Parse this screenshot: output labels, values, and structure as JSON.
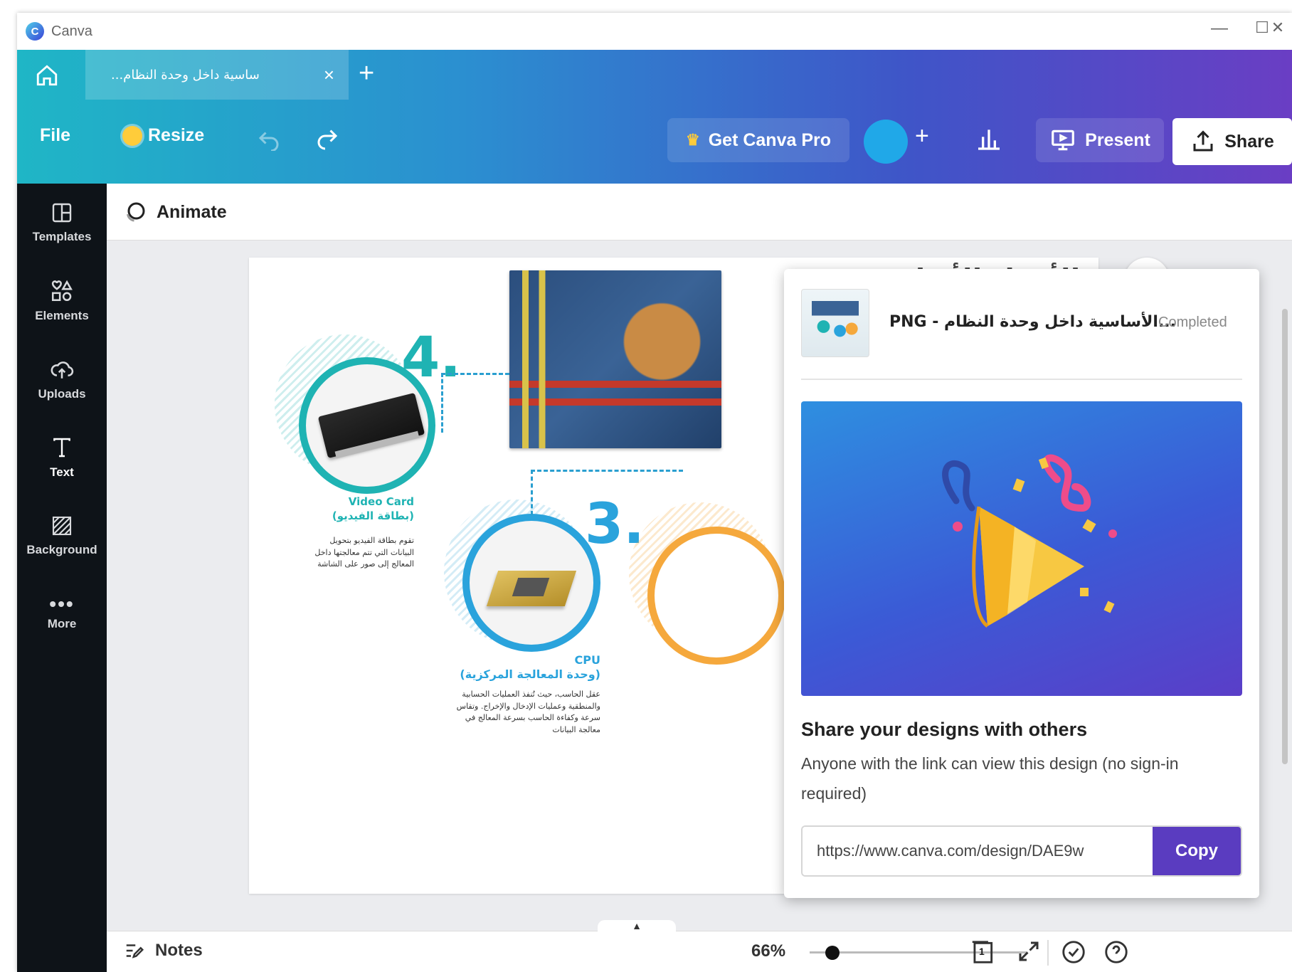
{
  "window": {
    "app_name": "Canva",
    "minimize": "—",
    "maximize": "☐",
    "close": "✕"
  },
  "tabs": {
    "active_tab_label": "...ساسية داخل وحدة النظام",
    "close": "×",
    "new": "+"
  },
  "toolbar": {
    "file": "File",
    "resize": "Resize",
    "get_pro": "Get Canva Pro",
    "plus": "+",
    "present": "Present",
    "share": "Share"
  },
  "sidebar": {
    "items": [
      {
        "label": "Templates",
        "icon": "templates-icon"
      },
      {
        "label": "Elements",
        "icon": "elements-icon"
      },
      {
        "label": "Uploads",
        "icon": "uploads-icon"
      },
      {
        "label": "Text",
        "icon": "text-icon"
      },
      {
        "label": "Background",
        "icon": "background-icon"
      },
      {
        "label": "More",
        "icon": "more-icon"
      }
    ]
  },
  "editor": {
    "animate": "Animate",
    "design": {
      "title_ar": "الأجزاء الأساسية",
      "step4": "4.",
      "step3": "3.",
      "video_card_en": "Video Card",
      "video_card_ar": "(بطاقة الفيديو)",
      "video_card_body": "تقوم بطاقة الفيديو بتحويل البيانات التي تتم معالجتها داخل المعالج إلى صور على الشاشة",
      "cpu_en": "CPU",
      "cpu_ar": "(وحدة المعالجة المركزية)",
      "cpu_body": "عقل الحاسب، حيث تُنفذ العمليات الحسابية والمنطقية وعمليات الإدخال والإخراج. وتقاس سرعة وكفاءة الحاسب بسرعة المعالج في معالجة البيانات"
    }
  },
  "bottom": {
    "notes": "Notes",
    "zoom": "66%",
    "page_count": "1"
  },
  "share_popup": {
    "download_name": "PNG - الأساسية داخل وحدة النظام...",
    "download_status": "Completed",
    "title": "Share your designs with others",
    "description": "Anyone with the link can view this design (no sign-in required)",
    "link_value": "https://www.canva.com/design/DAE9w",
    "copy": "Copy"
  },
  "colors": {
    "accent": "#5a3cc0",
    "teal": "#1fb3b3",
    "sidebar": "#0e1318"
  }
}
